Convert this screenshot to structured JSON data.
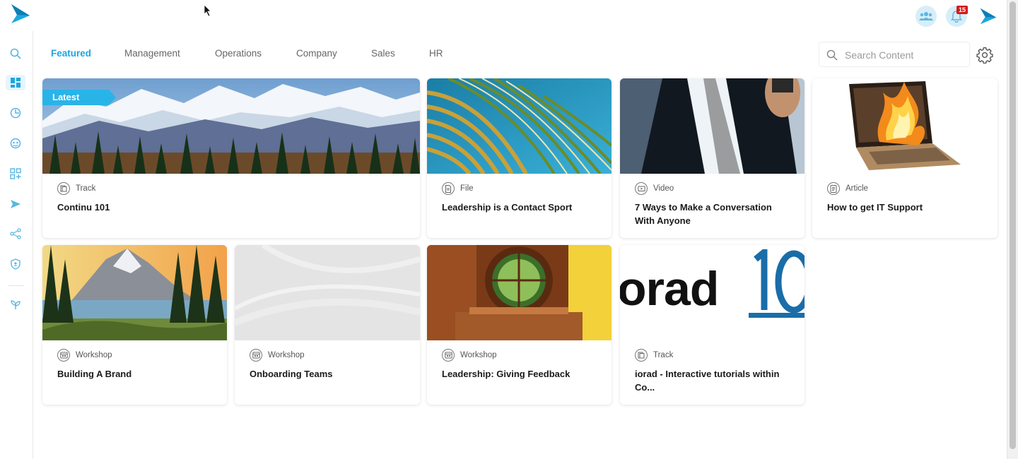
{
  "nav": {
    "tabs": [
      {
        "label": "Featured",
        "active": true
      },
      {
        "label": "Management",
        "active": false
      },
      {
        "label": "Operations",
        "active": false
      },
      {
        "label": "Company",
        "active": false
      },
      {
        "label": "Sales",
        "active": false
      },
      {
        "label": "HR",
        "active": false
      }
    ]
  },
  "search": {
    "placeholder": "Search Content",
    "value": ""
  },
  "header": {
    "notification_count": "15"
  },
  "sidebar": {
    "items": [
      "search-icon",
      "dashboard-icon",
      "analytics-icon",
      "people-icon",
      "apps-icon",
      "send-icon",
      "share-icon",
      "shield-icon",
      "plant-icon"
    ],
    "active": "dashboard-icon"
  },
  "colors": {
    "accent": "#1ba7e0",
    "badge": "#d51a1a",
    "sidebar_active_bg": "#e7f5fc"
  },
  "cards": [
    {
      "type": "Track",
      "type_icon": "track-icon",
      "title": "Continu 101",
      "ribbon": "Latest",
      "image": "mountain-forest-landscape"
    },
    {
      "type": "File",
      "type_icon": "file-icon",
      "title": "Leadership is a Contact Sport",
      "image": "palm-leaf"
    },
    {
      "type": "Video",
      "type_icon": "video-icon",
      "title": "7 Ways to Make a Conversation With Anyone",
      "image": "businessman-on-phone"
    },
    {
      "type": "Article",
      "type_icon": "article-icon",
      "title": "How to get IT Support",
      "image": "burning-laptop"
    },
    {
      "type": "Workshop",
      "type_icon": "workshop-icon",
      "title": "Building A Brand",
      "image": "mountain-lake-painting"
    },
    {
      "type": "Workshop",
      "type_icon": "workshop-icon",
      "title": "Onboarding Teams",
      "image": "light-gray-abstract"
    },
    {
      "type": "Workshop",
      "type_icon": "workshop-icon",
      "title": "Leadership: Giving Feedback",
      "image": "hobbit-hole-interior"
    },
    {
      "type": "Track",
      "type_icon": "track-icon",
      "title": "iorad - Interactive tutorials within Co...",
      "image": "iorad-logo-banner",
      "image_text": "orad"
    }
  ]
}
